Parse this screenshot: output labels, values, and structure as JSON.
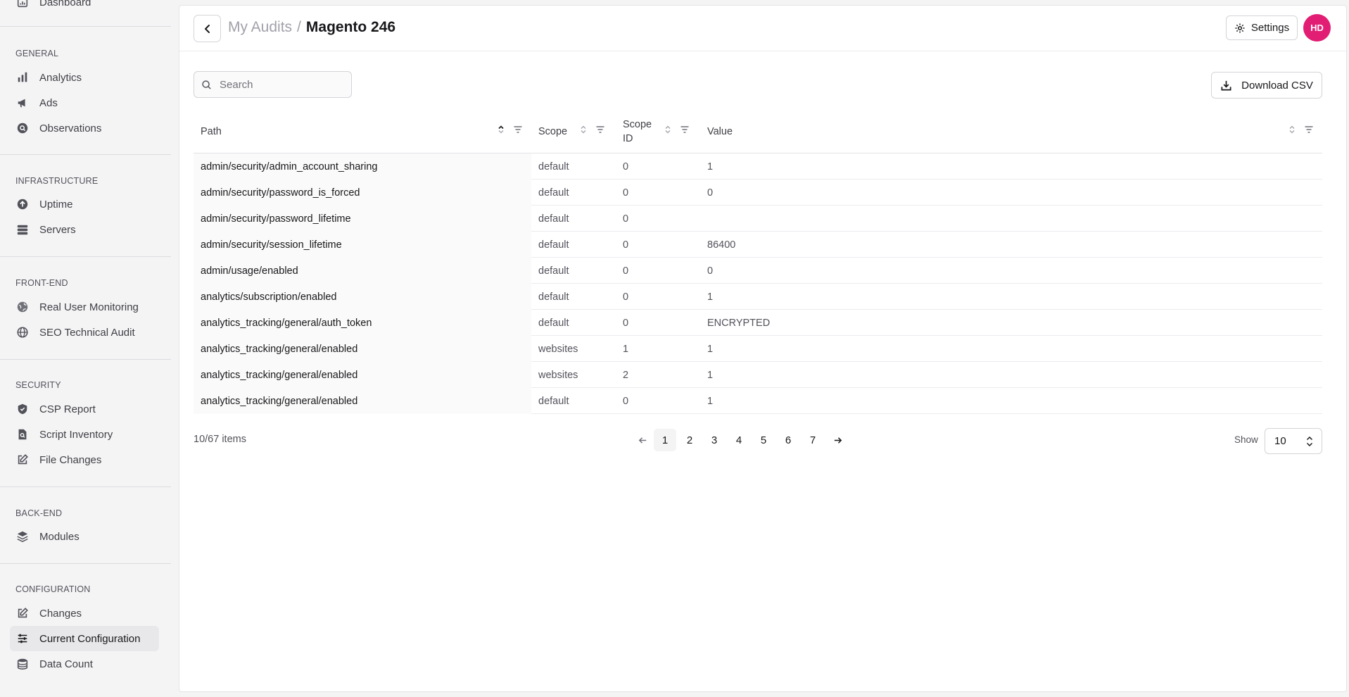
{
  "sidebar": {
    "top_item": "Dashboard",
    "sections": [
      {
        "heading": "GENERAL",
        "items": [
          {
            "label": "Analytics",
            "icon": "bar-chart-icon"
          },
          {
            "label": "Ads",
            "icon": "megaphone-icon"
          },
          {
            "label": "Observations",
            "icon": "search-circle-icon"
          }
        ]
      },
      {
        "heading": "INFRASTRUCTURE",
        "items": [
          {
            "label": "Uptime",
            "icon": "arrow-up-circle-icon"
          },
          {
            "label": "Servers",
            "icon": "server-stack-icon"
          }
        ]
      },
      {
        "heading": "FRONT-END",
        "items": [
          {
            "label": "Real User Monitoring",
            "icon": "globe-icon"
          },
          {
            "label": "SEO Technical Audit",
            "icon": "globe-grid-icon"
          }
        ]
      },
      {
        "heading": "SECURITY",
        "items": [
          {
            "label": "CSP Report",
            "icon": "shield-icon"
          },
          {
            "label": "Script Inventory",
            "icon": "file-search-icon"
          },
          {
            "label": "File Changes",
            "icon": "pencil-square-icon"
          }
        ]
      },
      {
        "heading": "BACK-END",
        "items": [
          {
            "label": "Modules",
            "icon": "layers-icon"
          }
        ]
      },
      {
        "heading": "CONFIGURATION",
        "items": [
          {
            "label": "Changes",
            "icon": "pencil-square-icon"
          },
          {
            "label": "Current Configuration",
            "icon": "sliders-icon",
            "active": true
          },
          {
            "label": "Data Count",
            "icon": "database-icon"
          }
        ]
      }
    ]
  },
  "header": {
    "breadcrumb_parent": "My Audits",
    "breadcrumb_sep": "/",
    "breadcrumb_current": "Magento 246",
    "settings_label": "Settings",
    "avatar_initials": "HD",
    "avatar_color": "#e11d74"
  },
  "toolbar": {
    "search_placeholder": "Search",
    "download_label": "Download CSV"
  },
  "table": {
    "columns": [
      {
        "label": "Path",
        "sort": "ascending"
      },
      {
        "label": "Scope",
        "sort": "none"
      },
      {
        "label": "Scope ID",
        "sort": "none"
      },
      {
        "label": "Value",
        "sort": "none"
      }
    ],
    "rows": [
      {
        "path": "admin/security/admin_account_sharing",
        "scope": "default",
        "scope_id": "0",
        "value": "1"
      },
      {
        "path": "admin/security/password_is_forced",
        "scope": "default",
        "scope_id": "0",
        "value": "0"
      },
      {
        "path": "admin/security/password_lifetime",
        "scope": "default",
        "scope_id": "0",
        "value": ""
      },
      {
        "path": "admin/security/session_lifetime",
        "scope": "default",
        "scope_id": "0",
        "value": "86400"
      },
      {
        "path": "admin/usage/enabled",
        "scope": "default",
        "scope_id": "0",
        "value": "0"
      },
      {
        "path": "analytics/subscription/enabled",
        "scope": "default",
        "scope_id": "0",
        "value": "1"
      },
      {
        "path": "analytics_tracking/general/auth_token",
        "scope": "default",
        "scope_id": "0",
        "value": "ENCRYPTED"
      },
      {
        "path": "analytics_tracking/general/enabled",
        "scope": "websites",
        "scope_id": "1",
        "value": "1"
      },
      {
        "path": "analytics_tracking/general/enabled",
        "scope": "websites",
        "scope_id": "2",
        "value": "1"
      },
      {
        "path": "analytics_tracking/general/enabled",
        "scope": "default",
        "scope_id": "0",
        "value": "1"
      }
    ]
  },
  "footer": {
    "item_count": "10/67 items",
    "pages": [
      "1",
      "2",
      "3",
      "4",
      "5",
      "6",
      "7"
    ],
    "current_page": "1",
    "show_label": "Show",
    "page_size": "10"
  }
}
